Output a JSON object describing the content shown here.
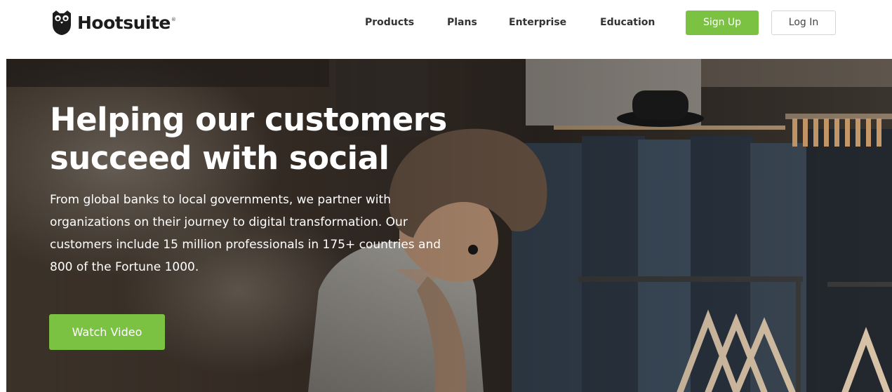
{
  "header": {
    "logo_text": "Hootsuite",
    "logo_mark": "®",
    "logo_icon": "owl-icon",
    "nav": [
      {
        "label": "Products"
      },
      {
        "label": "Plans"
      },
      {
        "label": "Enterprise"
      },
      {
        "label": "Education"
      }
    ],
    "signup_label": "Sign Up",
    "login_label": "Log In"
  },
  "hero": {
    "title_lines": [
      "Helping our customers",
      "succeed with social"
    ],
    "body_lines": [
      "From global banks to local governments, we partner with",
      "organizations on their journey to digital transformation. Our",
      "customers include 15 million professionals in 175+ countries and",
      "800 of the Fortune 1000."
    ],
    "cta_label": "Watch Video",
    "background": "photo of a man browsing clothing racks in a store"
  },
  "colors": {
    "accent_green": "#7cc242",
    "text_dark": "#333333",
    "white": "#ffffff"
  }
}
